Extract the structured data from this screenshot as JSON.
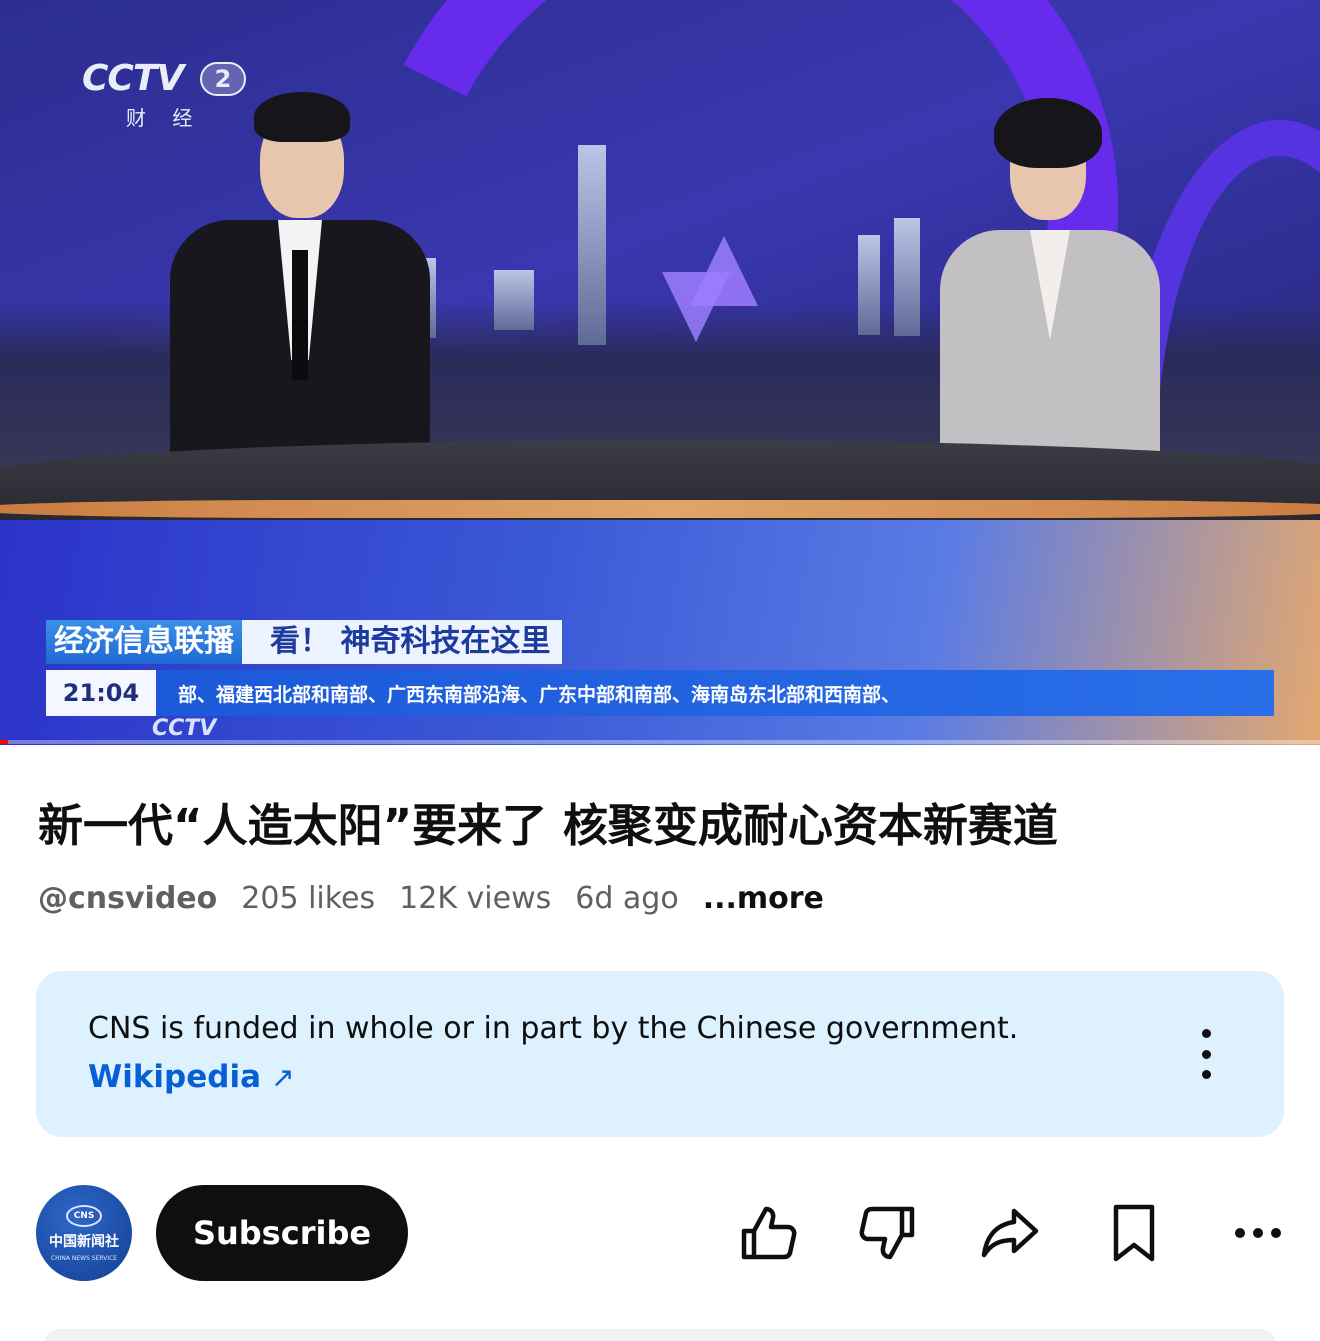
{
  "video": {
    "channel_logo": "CCTV",
    "channel_number": "2",
    "channel_sub": "财 经",
    "program_name": "经济信息联播",
    "headline": "看！ 神奇科技在这里",
    "clock": "21:04",
    "ticker": "部、福建西北部和南部、广西东南部沿海、广东中部和南部、海南岛东北部和西南部、",
    "bug_logo": "CCTV",
    "progress_fraction": 0.006
  },
  "details": {
    "title": "新一代“人造太阳”要来了 核聚变成耐心资本新赛道",
    "channel_handle": "@cnsvideo",
    "likes": "205 likes",
    "views": "12K views",
    "age": "6d ago",
    "more_label": "...more"
  },
  "info_panel": {
    "text": "CNS is funded in whole or in part by the Chinese government.",
    "link_label": "Wikipedia",
    "link_arrow": "↗"
  },
  "channel": {
    "avatar_badge": "CNS",
    "avatar_name": "中国新闻社",
    "avatar_sub": "CHINA NEWS SERVICE",
    "subscribe_label": "Subscribe"
  },
  "actions": {
    "icons": [
      "like-icon",
      "dislike-icon",
      "share-icon",
      "save-icon",
      "more-icon"
    ]
  },
  "colors": {
    "accent_link": "#065fd4",
    "info_bg": "#def1ff",
    "subscribe_bg": "#0f0f0f",
    "progress": "#ff0000"
  }
}
